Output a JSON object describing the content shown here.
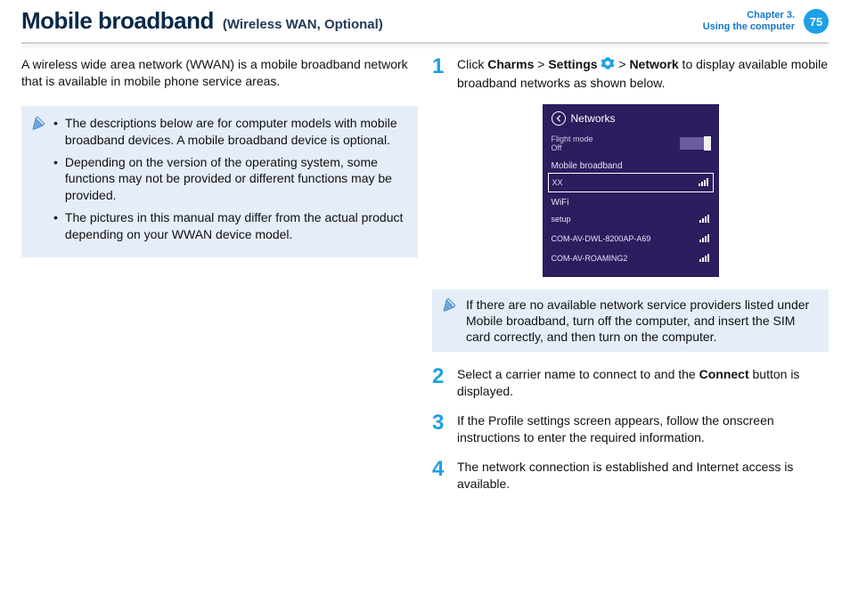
{
  "header": {
    "title": "Mobile broadband",
    "subtitle": "(Wireless WAN, Optional)",
    "chapter_line1": "Chapter 3.",
    "chapter_line2": "Using the computer",
    "page_number": "75"
  },
  "left": {
    "intro": "A wireless wide area network (WWAN) is a mobile broadband network that is available in mobile phone service areas.",
    "notes": [
      "The descriptions below are for computer models with mobile broadband devices. A mobile broadband device is optional.",
      "Depending on the version of the operating system, some functions may not be provided or different functions may be provided.",
      "The pictures in this manual may differ from the actual product depending on your WWAN device model."
    ]
  },
  "right": {
    "step1": {
      "num": "1",
      "pre": "Click ",
      "charms": "Charms",
      "gt1": " > ",
      "settings": "Settings",
      "space": " ",
      "gt2": " > ",
      "network": "Network",
      "post": " to display available mobile broadband networks as shown below."
    },
    "networks_panel": {
      "title": "Networks",
      "flight_label": "Flight mode",
      "flight_value": "Off",
      "section_mobile": "Mobile broadband",
      "mobile_item": "XX",
      "section_wifi": "WiFi",
      "wifi_items": [
        "setup",
        "COM-AV-DWL-8200AP-A69",
        "COM-AV-ROAMING2"
      ]
    },
    "tip": "If there are no available network service providers listed under Mobile broadband, turn off the computer, and insert the SIM card correctly, and then turn on the computer.",
    "step2": {
      "num": "2",
      "pre": "Select a carrier name to connect to and the ",
      "connect": "Connect",
      "post": " button is displayed."
    },
    "step3": {
      "num": "3",
      "text": "If the Profile settings screen appears, follow the onscreen instructions to enter the required information."
    },
    "step4": {
      "num": "4",
      "text": "The network connection is established and Internet access is available."
    }
  }
}
